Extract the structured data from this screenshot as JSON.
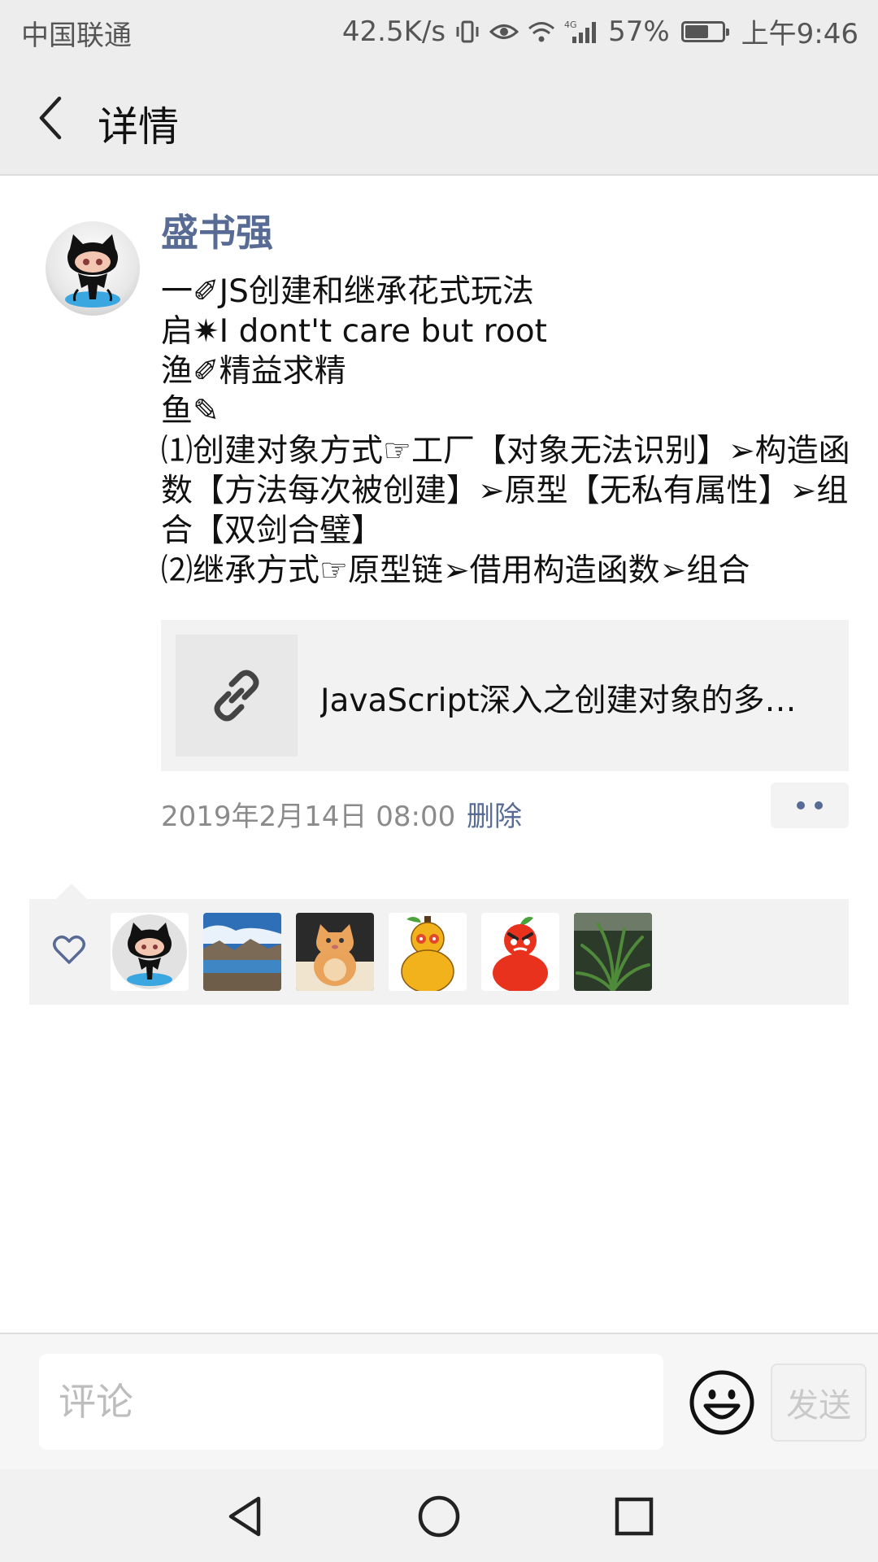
{
  "status_bar": {
    "carrier": "中国联通",
    "speed": "42.5K/s",
    "network": "4G",
    "battery": "57%",
    "time": "上午9:46"
  },
  "header": {
    "title": "详情",
    "back_icon": "back-chevron-icon"
  },
  "post": {
    "author": "盛书强",
    "lines": [
      "一✐JS创建和继承花式玩法",
      "启✷I dont't care but root",
      "渔✐精益求精",
      "鱼✎",
      "⑴创建对象方式☞工厂【对象无法识别】➢构造函数【方法每次被创建】➢原型【无私有属性】➢组合【双剑合璧】",
      "⑵继承方式☞原型链➢借用构造函数➢组合"
    ],
    "link": {
      "icon": "link-icon",
      "title": "JavaScript深入之创建对象的多种方式以及优缺点"
    },
    "timestamp": "2019年2月14日 08:00",
    "delete_label": "删除",
    "more_icon": "more-dots-icon"
  },
  "likes": {
    "icon": "heart-icon",
    "users": [
      {
        "avatar": "octocat-avatar"
      },
      {
        "avatar": "landscape-avatar"
      },
      {
        "avatar": "cat-avatar"
      },
      {
        "avatar": "gourd-yellow-avatar"
      },
      {
        "avatar": "gourd-red-avatar"
      },
      {
        "avatar": "plant-avatar"
      }
    ]
  },
  "comment_bar": {
    "placeholder": "评论",
    "emoji_icon": "emoji-icon",
    "send_label": "发送"
  },
  "nav_bar": {
    "back": "nav-back-icon",
    "home": "nav-home-icon",
    "recents": "nav-recents-icon"
  }
}
